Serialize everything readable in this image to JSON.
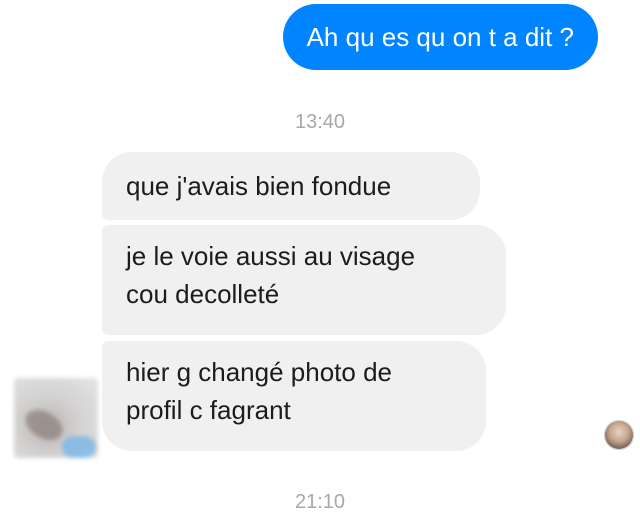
{
  "conversation": {
    "outgoing": [
      {
        "text": "Ah qu es qu on t a dit ?"
      }
    ],
    "timestamps": [
      "13:40",
      "21:10"
    ],
    "incoming": [
      {
        "text": "que j'avais bien fondue"
      },
      {
        "line1": "je le voie aussi au visage",
        "line2": "cou decolleté"
      },
      {
        "line1": "hier g changé photo de",
        "line2": "profil c fagrant"
      }
    ]
  },
  "colors": {
    "outgoing_bubble": "#0084ff",
    "incoming_bubble": "#f1f0f0",
    "timestamp_text": "#a8a8a8"
  }
}
